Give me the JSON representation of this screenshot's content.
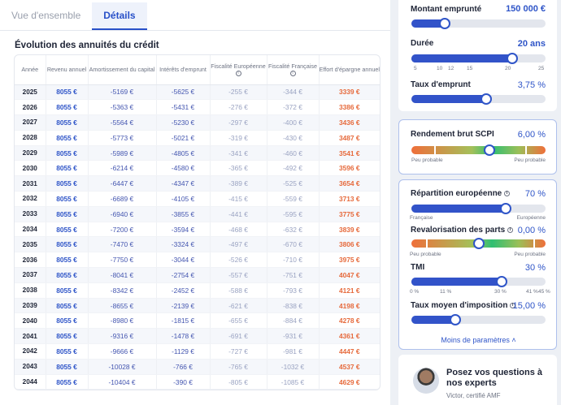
{
  "tabs": [
    {
      "label": "Vue d'ensemble"
    },
    {
      "label": "Détails"
    }
  ],
  "table": {
    "title": "Évolution des annuités du crédit",
    "headers": [
      "Année",
      "Revenu annuel",
      "Amortissement du capital",
      "Intérêts d'emprunt",
      "Fiscalité Européenne",
      "Fiscalité Française",
      "Effort d'épargne annuel"
    ],
    "rows": [
      [
        "2025",
        "8055 €",
        "-5169 €",
        "-5625 €",
        "-255 €",
        "-344 €",
        "3339 €"
      ],
      [
        "2026",
        "8055 €",
        "-5363 €",
        "-5431 €",
        "-276 €",
        "-372 €",
        "3386 €"
      ],
      [
        "2027",
        "8055 €",
        "-5564 €",
        "-5230 €",
        "-297 €",
        "-400 €",
        "3436 €"
      ],
      [
        "2028",
        "8055 €",
        "-5773 €",
        "-5021 €",
        "-319 €",
        "-430 €",
        "3487 €"
      ],
      [
        "2029",
        "8055 €",
        "-5989 €",
        "-4805 €",
        "-341 €",
        "-460 €",
        "3541 €"
      ],
      [
        "2030",
        "8055 €",
        "-6214 €",
        "-4580 €",
        "-365 €",
        "-492 €",
        "3596 €"
      ],
      [
        "2031",
        "8055 €",
        "-6447 €",
        "-4347 €",
        "-389 €",
        "-525 €",
        "3654 €"
      ],
      [
        "2032",
        "8055 €",
        "-6689 €",
        "-4105 €",
        "-415 €",
        "-559 €",
        "3713 €"
      ],
      [
        "2033",
        "8055 €",
        "-6940 €",
        "-3855 €",
        "-441 €",
        "-595 €",
        "3775 €"
      ],
      [
        "2034",
        "8055 €",
        "-7200 €",
        "-3594 €",
        "-468 €",
        "-632 €",
        "3839 €"
      ],
      [
        "2035",
        "8055 €",
        "-7470 €",
        "-3324 €",
        "-497 €",
        "-670 €",
        "3806 €"
      ],
      [
        "2036",
        "8055 €",
        "-7750 €",
        "-3044 €",
        "-526 €",
        "-710 €",
        "3975 €"
      ],
      [
        "2037",
        "8055 €",
        "-8041 €",
        "-2754 €",
        "-557 €",
        "-751 €",
        "4047 €"
      ],
      [
        "2038",
        "8055 €",
        "-8342 €",
        "-2452 €",
        "-588 €",
        "-793 €",
        "4121 €"
      ],
      [
        "2039",
        "8055 €",
        "-8655 €",
        "-2139 €",
        "-621 €",
        "-838 €",
        "4198 €"
      ],
      [
        "2040",
        "8055 €",
        "-8980 €",
        "-1815 €",
        "-655 €",
        "-884 €",
        "4278 €"
      ],
      [
        "2041",
        "8055 €",
        "-9316 €",
        "-1478 €",
        "-691 €",
        "-931 €",
        "4361 €"
      ],
      [
        "2042",
        "8055 €",
        "-9666 €",
        "-1129 €",
        "-727 €",
        "-981 €",
        "4447 €"
      ],
      [
        "2043",
        "8055 €",
        "-10028 €",
        "-766 €",
        "-765 €",
        "-1032 €",
        "4537 €"
      ],
      [
        "2044",
        "8055 €",
        "-10404 €",
        "-390 €",
        "-805 €",
        "-1085 €",
        "4629 €"
      ]
    ]
  },
  "params": {
    "montant": {
      "label": "Montant emprunté",
      "value": "150 000 €",
      "level": 0.25
    },
    "duree": {
      "label": "Durée",
      "value": "20 ans",
      "ticks": [
        "5",
        "10",
        "12",
        "15",
        "20",
        "25"
      ],
      "level": 0.75
    },
    "taux": {
      "label": "Taux d'emprunt",
      "value": "3,75 %",
      "level": 0.56
    },
    "rendement": {
      "label": "Rendement brut SCPI",
      "value": "6,00 %",
      "left_caption": "Peu probable",
      "right_caption": "Peu probable",
      "level": 0.58
    },
    "repartition": {
      "label": "Répartition européenne",
      "value": "70 %",
      "left_caption": "Française",
      "right_caption": "Européenne",
      "level": 0.7
    },
    "revalorisation": {
      "label": "Revalorisation des parts",
      "value": "0,00 %",
      "left_caption": "Peu probable",
      "right_caption": "Peu probable",
      "level": 0.5
    },
    "tmi": {
      "label": "TMI",
      "value": "30 %",
      "ticks": [
        "0 %",
        "11 %",
        "30 %",
        "41 %",
        "45 %"
      ],
      "level": 0.67
    },
    "taux_moyen": {
      "label": "Taux moyen d'imposition",
      "value": "15,00 %",
      "level": 0.33
    },
    "less_label": "Moins de paramètres"
  },
  "expert": {
    "title": "Posez vos questions à nos experts",
    "subtitle": "Victor, certifié AMF"
  },
  "colors": {
    "accent": "#2f55c8",
    "effort": "#e66a3c",
    "muted": "#9aa3c2"
  }
}
